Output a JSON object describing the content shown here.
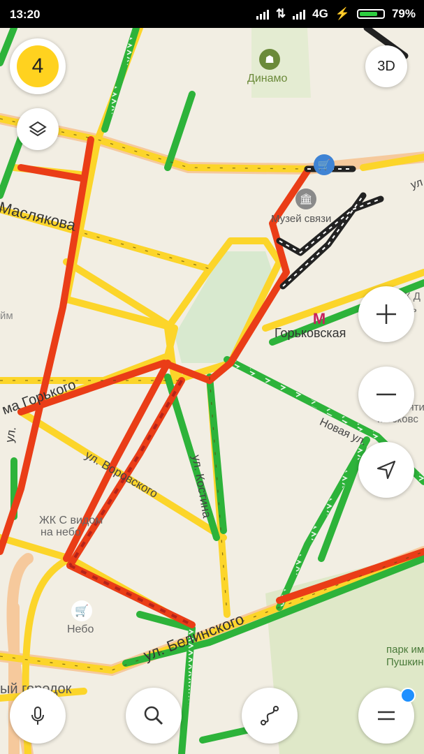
{
  "status_bar": {
    "time": "13:20",
    "network": "4G",
    "battery": "79%",
    "battery_level": 0.79
  },
  "traffic": {
    "score": "4",
    "score_color": "#ffd21f"
  },
  "buttons": {
    "three_d": "3D"
  },
  "colors": {
    "green": "#2db33a",
    "yellow": "#fcd52a",
    "red": "#ea3d17",
    "dark_red": "#b5231a",
    "road": "#f6c99c",
    "park": "#dfe8c8"
  },
  "map_labels": {
    "dinamo": "Динамо",
    "museum": "Музей связи",
    "gorkovskaya": "Горьковская",
    "maslyakova": "Маслякова",
    "maxim_gorkogo": "ма Горького",
    "vorovskogo": "ул. Воровского",
    "kostina": "ул. Костина",
    "novaya": "Новая ул.",
    "belinskogo": "ул. Белинского",
    "zhk_s_vidom": "ЖК С видом",
    "na_nebo": "на небо",
    "nebo": "Небо",
    "gorodok": "ый городок",
    "park": "парк им.",
    "pushkin": "Пушкина",
    "hram": "Храм святи",
    "moskovsk": "Московс",
    "zhk_right": "ЖК Д",
    "gorky_right": "Горь",
    "ul_left": "ул.",
    "im_left": "йм",
    "ul_right": "ул"
  },
  "icons": {
    "layers": "layers-icon",
    "zoom_in": "plus-icon",
    "zoom_out": "minus-icon",
    "locate": "navigation-arrow-icon",
    "voice": "microphone-icon",
    "search": "search-icon",
    "route": "route-icon",
    "menu": "menu-icon",
    "metro": "metro-icon",
    "stadium": "stadium-icon",
    "museum": "museum-icon",
    "shop": "shopping-cart-icon"
  }
}
